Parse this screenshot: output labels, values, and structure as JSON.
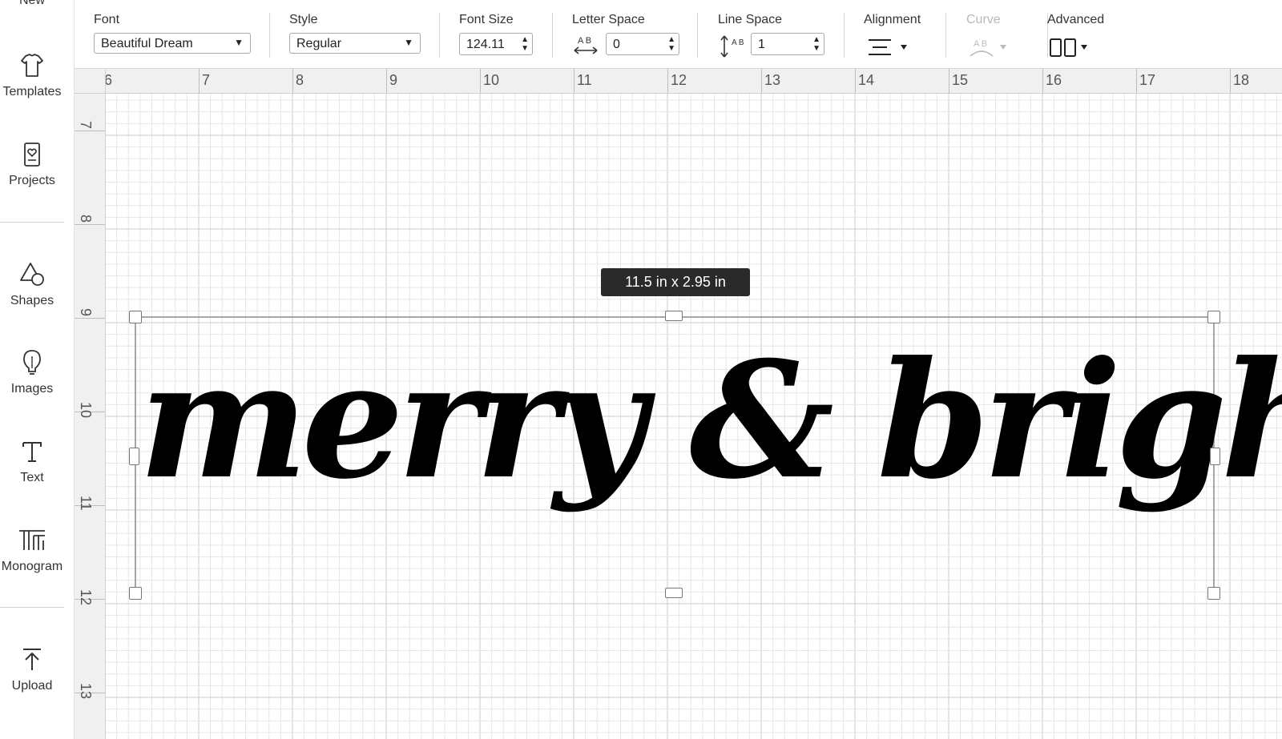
{
  "sidebar": {
    "items": [
      {
        "label": "New"
      },
      {
        "label": "Templates"
      },
      {
        "label": "Projects"
      },
      {
        "label": "Shapes"
      },
      {
        "label": "Images"
      },
      {
        "label": "Text"
      },
      {
        "label": "Monogram"
      },
      {
        "label": "Upload"
      }
    ]
  },
  "toolbar": {
    "font": {
      "label": "Font",
      "value": "Beautiful Dream"
    },
    "style": {
      "label": "Style",
      "value": "Regular"
    },
    "font_size": {
      "label": "Font Size",
      "value": "124.11"
    },
    "letter_space": {
      "label": "Letter Space",
      "value": "0",
      "icon_text": "A B"
    },
    "line_space": {
      "label": "Line Space",
      "value": "1",
      "icon_text": "A B"
    },
    "alignment": {
      "label": "Alignment"
    },
    "curve": {
      "label": "Curve",
      "disabled": true,
      "icon_text": "A B"
    },
    "advanced": {
      "label": "Advanced"
    }
  },
  "ruler": {
    "horizontal": [
      "6",
      "7",
      "8",
      "9",
      "10",
      "11",
      "12",
      "13",
      "14",
      "15",
      "16",
      "17",
      "18"
    ],
    "vertical": [
      "7",
      "8",
      "9",
      "10",
      "11",
      "12",
      "13"
    ]
  },
  "canvas": {
    "dimension_tooltip": "11.5  in x 2.95  in",
    "design_text": "merry & bright"
  },
  "colors": {
    "grid_minor": "#e6e6e6",
    "grid_major": "#cbcbcb",
    "text": "#000000",
    "tooltip_bg": "#2a2a2a"
  }
}
